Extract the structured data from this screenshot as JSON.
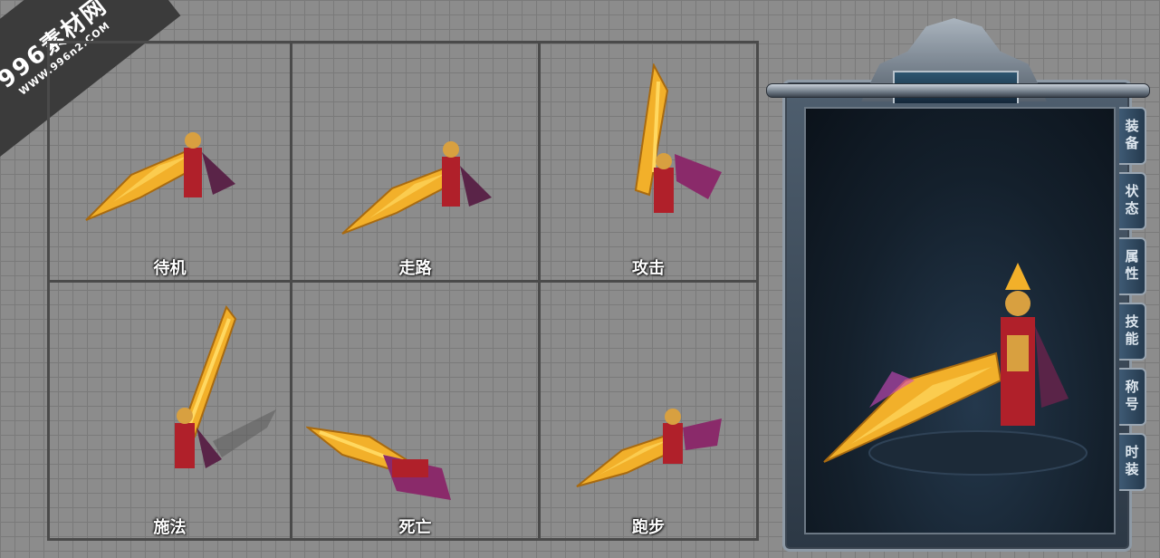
{
  "watermark": {
    "main": "996素材网",
    "sub": "WWW.996n2.COM"
  },
  "sprite_sheet": {
    "cells": [
      {
        "label": "待机"
      },
      {
        "label": "走路"
      },
      {
        "label": "攻击"
      },
      {
        "label": "施法"
      },
      {
        "label": "死亡"
      },
      {
        "label": "跑步"
      }
    ]
  },
  "character_panel": {
    "tabs": [
      "装备",
      "状态",
      "属性",
      "技能",
      "称号",
      "时装"
    ]
  },
  "colors": {
    "grid_bg": "#8c8c8c",
    "grid_border": "#4a4a4a",
    "blade_gold": "#f2b02a",
    "armor_red": "#b0202a",
    "cape_purple": "#8a2a6a",
    "panel_dark": "#14202c"
  }
}
